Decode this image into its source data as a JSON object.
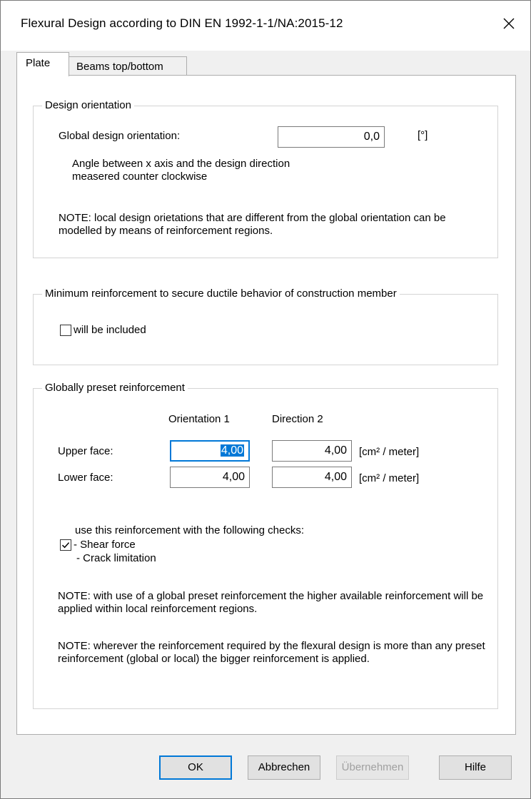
{
  "window": {
    "title": "Flexural Design according to DIN EN 1992-1-1/NA:2015-12",
    "close_icon": "close-icon"
  },
  "tabs": [
    {
      "label": "Plate",
      "active": true
    },
    {
      "label": "Beams top/bottom",
      "active": false
    }
  ],
  "design_orientation": {
    "legend": "Design orientation",
    "global_label": "Global design orientation:",
    "global_value": "0,0",
    "unit": "[°]",
    "description": "Angle between x axis and the design direction measered counter clockwise",
    "note": "NOTE: local design orietations that are different from the global orientation can be modelled by means of reinforcement regions."
  },
  "minimum_reinforcement": {
    "legend": "Minimum reinforcement to secure ductile behavior of construction member",
    "checkbox_label": "will be included",
    "checked": false
  },
  "preset_reinforcement": {
    "legend": "Globally preset reinforcement",
    "col1_header": "Orientation 1",
    "col2_header": "Direction 2",
    "upper_label": "Upper face:",
    "lower_label": "Lower face:",
    "upper_values": [
      "4,00",
      "4,00"
    ],
    "lower_values": [
      "4,00",
      "4,00"
    ],
    "unit": "[cm² / meter]",
    "use_label": "use this reinforcement with the following checks:",
    "use_checked": true,
    "check_items": [
      "- Shear force",
      "- Crack limitation"
    ],
    "note1": "NOTE: with use of a global preset reinforcement the higher available reinforcement will be applied within local reinforcement regions.",
    "note2": "NOTE: wherever the reinforcement required by the flexural design is more than any preset reinforcement (global or local) the bigger reinforcement is applied."
  },
  "buttons": {
    "ok": "OK",
    "cancel": "Abbrechen",
    "apply": "Übernehmen",
    "help": "Hilfe"
  },
  "colors": {
    "accent": "#0078d7",
    "window_bg": "#f0f0f0",
    "page_bg": "#ffffff",
    "disabled_text": "#a0a0a0"
  }
}
